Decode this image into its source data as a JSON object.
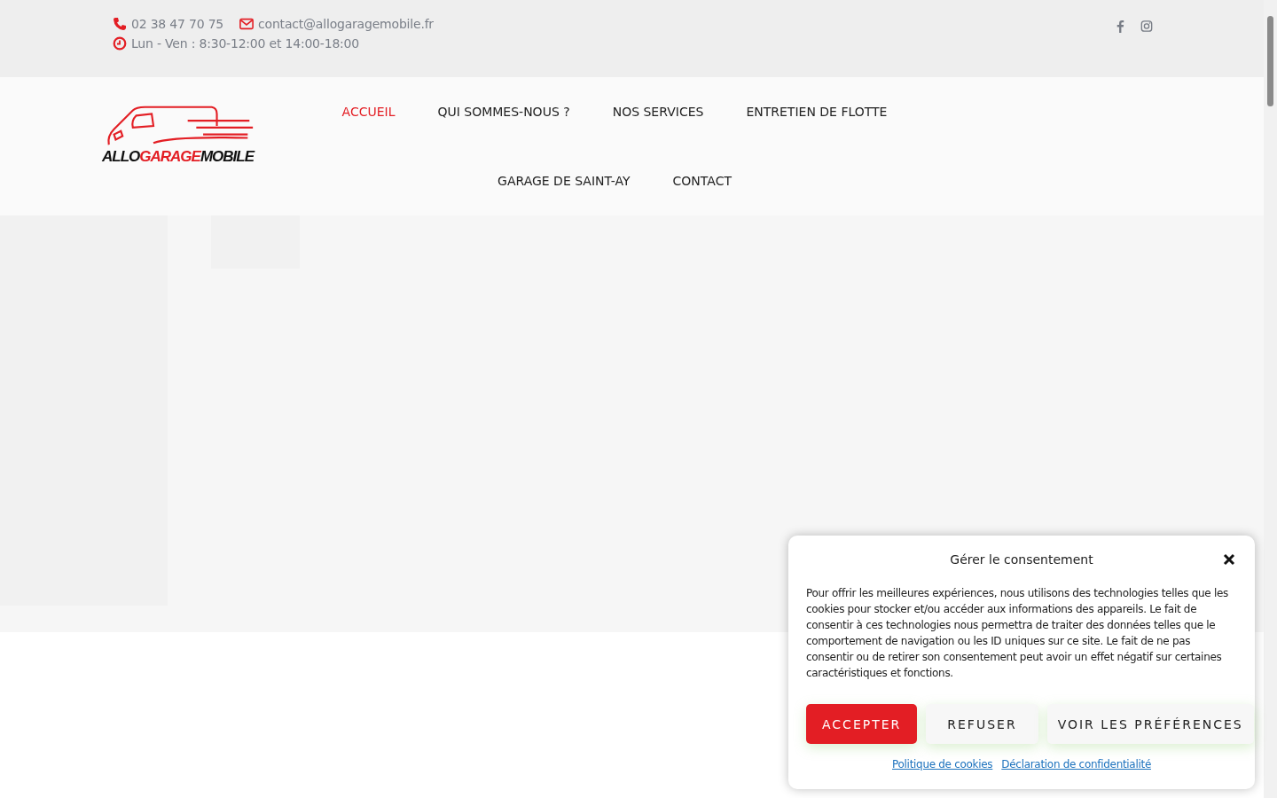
{
  "topbar": {
    "phone": "02 38 47 70 75",
    "email": "contact@allogaragemobile.fr",
    "hours": "Lun - Ven : 8:30-12:00 et 14:00-18:00",
    "social": [
      {
        "kind": "facebook"
      },
      {
        "kind": "instagram"
      }
    ]
  },
  "logo": {
    "parts": [
      {
        "text": "ALLO",
        "kind": "dark"
      },
      {
        "text": "GARAGE",
        "kind": "accent"
      },
      {
        "text": "MOBILE",
        "kind": "dark"
      }
    ]
  },
  "nav": {
    "rows": [
      [
        {
          "label": "ACCUEIL",
          "selected": true
        },
        {
          "label": "QUI SOMMES-NOUS ?",
          "selected": false
        },
        {
          "label": "NOS SERVICES",
          "selected": false
        },
        {
          "label": "ENTRETIEN DE FLOTTE",
          "selected": false
        }
      ],
      [
        {
          "label": "GARAGE DE SAINT-AY",
          "selected": false
        },
        {
          "label": "CONTACT",
          "selected": false
        }
      ]
    ]
  },
  "consent": {
    "title": "Gérer le consentement",
    "text": "Pour offrir les meilleures expériences, nous utilisons des technologies telles que les cookies pour stocker et/ou accéder aux informations des appareils. Le fait de consentir à ces technologies nous permettra de traiter des données telles que le comportement de navigation ou les ID uniques sur ce site. Le fait de ne pas consentir ou de retirer son consentement peut avoir un effet négatif sur certaines caractéristiques et fonctions.",
    "buttons": [
      {
        "label": "ACCEPTER",
        "kind": "primary"
      },
      {
        "label": "REFUSER",
        "kind": "secondary"
      },
      {
        "label": "VOIR LES PRÉFÉRENCES",
        "kind": "secondary"
      }
    ],
    "links": [
      "Politique de cookies",
      "Déclaration de confidentialité"
    ]
  }
}
